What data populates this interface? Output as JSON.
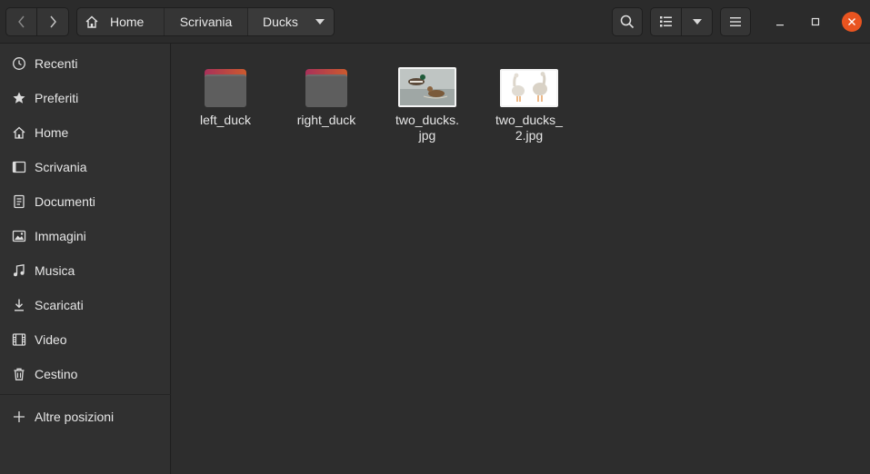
{
  "header": {
    "back_icon": "chevron-left-icon",
    "forward_icon": "chevron-right-icon",
    "breadcrumb": [
      {
        "label": "Home",
        "icon": "home-icon"
      },
      {
        "label": "Scrivania"
      },
      {
        "label": "Ducks"
      }
    ],
    "search_icon": "search-icon",
    "view_icon": "list-view-icon",
    "menu_icon": "hamburger-menu-icon",
    "accent_close": "#e95420"
  },
  "sidebar": {
    "items": [
      {
        "label": "Recenti",
        "icon": "clock-icon"
      },
      {
        "label": "Preferiti",
        "icon": "star-icon"
      },
      {
        "label": "Home",
        "icon": "home-icon"
      },
      {
        "label": "Scrivania",
        "icon": "desktop-icon"
      },
      {
        "label": "Documenti",
        "icon": "document-icon"
      },
      {
        "label": "Immagini",
        "icon": "image-icon"
      },
      {
        "label": "Musica",
        "icon": "music-icon"
      },
      {
        "label": "Scaricati",
        "icon": "download-icon"
      },
      {
        "label": "Video",
        "icon": "video-icon"
      },
      {
        "label": "Cestino",
        "icon": "trash-icon"
      }
    ],
    "other_locations": {
      "label": "Altre posizioni",
      "icon": "plus-icon"
    }
  },
  "files": [
    {
      "name": "left_duck",
      "type": "folder"
    },
    {
      "name": "right_duck",
      "type": "folder"
    },
    {
      "name": "two_ducks.\njpg",
      "type": "image"
    },
    {
      "name": "two_ducks_\n2.jpg",
      "type": "image"
    }
  ]
}
